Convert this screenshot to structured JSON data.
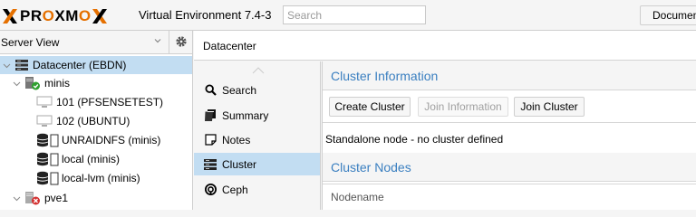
{
  "header": {
    "brand_p1": "PR",
    "brand_o1": "O",
    "brand_p2": "XM",
    "brand_o2": "O",
    "version": "Virtual Environment 7.4-3",
    "search_placeholder": "Search",
    "docs_label": "Documentation"
  },
  "tree": {
    "view_label": "Server View",
    "items": [
      {
        "label": "Datacenter (EBDN)",
        "icon": "datacenter-icon"
      },
      {
        "label": "minis",
        "icon": "node-online-icon"
      },
      {
        "label": "101 (PFSENSETEST)",
        "icon": "vm-icon"
      },
      {
        "label": "102 (UBUNTU)",
        "icon": "vm-icon"
      },
      {
        "label": "UNRAIDNFS (minis)",
        "icon": "storage-icon"
      },
      {
        "label": "local (minis)",
        "icon": "storage-icon"
      },
      {
        "label": "local-lvm (minis)",
        "icon": "storage-icon"
      },
      {
        "label": "pve1",
        "icon": "node-offline-icon"
      }
    ]
  },
  "breadcrumb": "Datacenter",
  "nav": {
    "items": [
      {
        "label": "Search",
        "icon": "search-icon"
      },
      {
        "label": "Summary",
        "icon": "book-icon"
      },
      {
        "label": "Notes",
        "icon": "notes-icon"
      },
      {
        "label": "Cluster",
        "icon": "cluster-icon"
      },
      {
        "label": "Ceph",
        "icon": "ceph-icon"
      }
    ],
    "selected": "Cluster"
  },
  "content": {
    "cluster_info_title": "Cluster Information",
    "buttons": {
      "create": "Create Cluster",
      "join_info": "Join Information",
      "join": "Join Cluster"
    },
    "status": "Standalone node - no cluster defined",
    "nodes_title": "Cluster Nodes",
    "col_nodename": "Nodename"
  },
  "colors": {
    "brand_orange": "#e57000",
    "accent_blue": "#3a7fc0",
    "selection": "#c2ddf2"
  }
}
